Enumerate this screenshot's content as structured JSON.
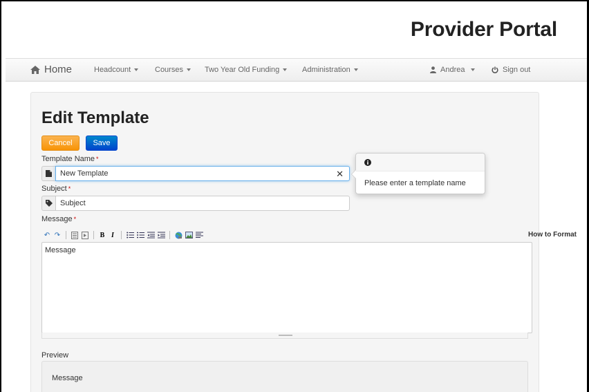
{
  "header": {
    "title": "Provider Portal"
  },
  "nav": {
    "home": "Home",
    "items": [
      {
        "label": "Headcount"
      },
      {
        "label": "Courses"
      },
      {
        "label": "Two Year Old Funding"
      },
      {
        "label": "Administration"
      }
    ],
    "user": "Andrea",
    "signout": "Sign out"
  },
  "page": {
    "title": "Edit Template"
  },
  "buttons": {
    "cancel": "Cancel",
    "save": "Save"
  },
  "form": {
    "template_name": {
      "label": "Template Name",
      "value": "New Template"
    },
    "subject": {
      "label": "Subject",
      "placeholder": "Subject"
    },
    "message": {
      "label": "Message",
      "placeholder": "Message",
      "how_to_format": "How to Format"
    },
    "required_marker": "*"
  },
  "popover": {
    "text": "Please enter a template name"
  },
  "preview": {
    "label": "Preview",
    "content": "Message"
  },
  "colors": {
    "cancel": "#f89406",
    "save": "#0044cc",
    "focus": "#66afe9"
  }
}
